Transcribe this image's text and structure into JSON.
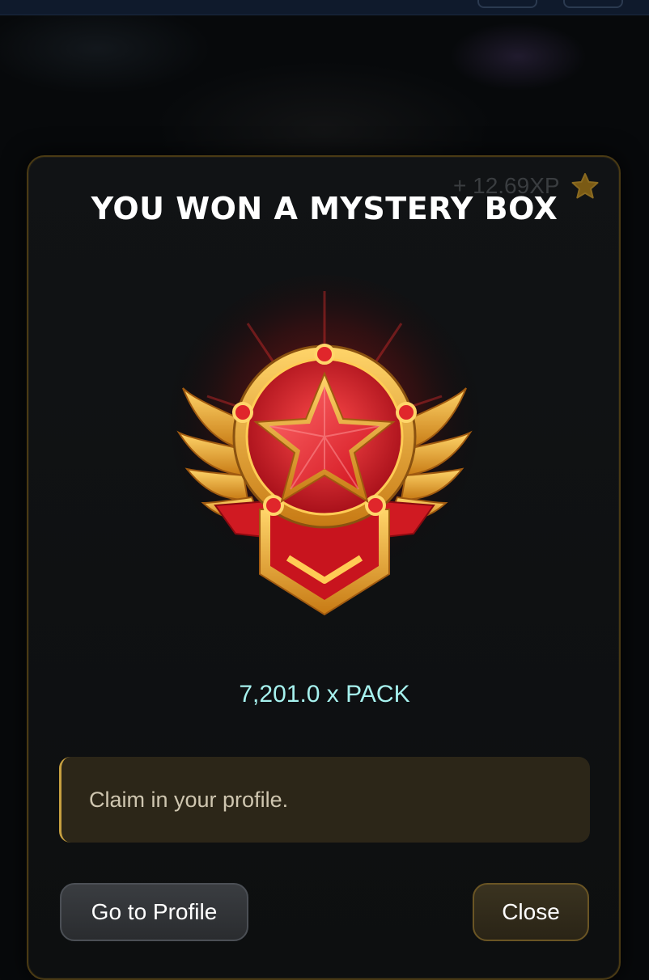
{
  "modal": {
    "xp_label": "+ 12.69XP",
    "title": "YOU WON A MYSTERY BOX",
    "reward": "7,201.0 x PACK",
    "notice": "Claim in your profile.",
    "buttons": {
      "profile": "Go to Profile",
      "close": "Close"
    }
  },
  "icons": {
    "xp": "star-icon",
    "reward": "winged-star-medal-icon"
  },
  "colors": {
    "reward_text": "#a6f1ee",
    "accent_gold": "#c7a040",
    "medal_red": "#e0262b"
  }
}
